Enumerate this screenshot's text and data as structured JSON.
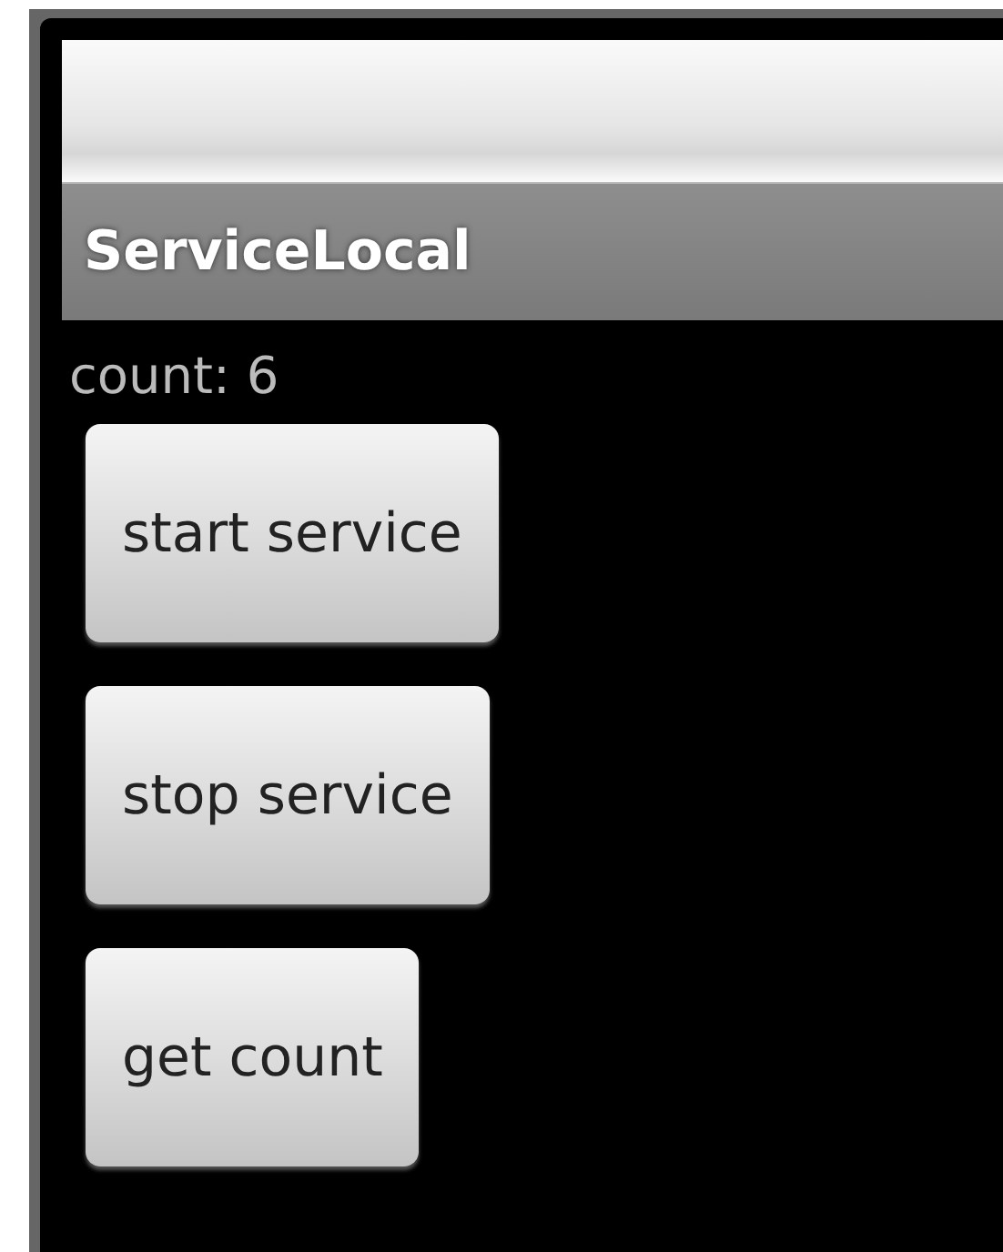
{
  "title_bar": {
    "title": "ServiceLocal"
  },
  "count_label": "count: 6",
  "buttons": [
    {
      "label": "start service"
    },
    {
      "label": "stop service"
    },
    {
      "label": "get count"
    }
  ]
}
